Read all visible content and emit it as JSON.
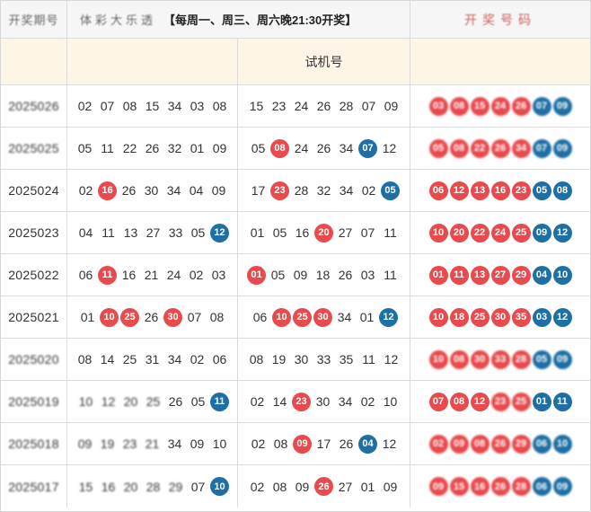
{
  "colors": {
    "red_ball": "#e84a4d",
    "blue_ball": "#1e6fa3",
    "header_bg": "#fdf6e7"
  },
  "top_bar": {
    "left_label": "开奖期号",
    "middle_prefix": "体彩大乐透",
    "draw_schedule": "【每周一、周三、周六晚21:30开奖】",
    "right_label": "开奖号码"
  },
  "header": {
    "trial_label": "试机号"
  },
  "rows": [
    {
      "date": "2025026",
      "date_blurred": true,
      "col1": [
        {
          "n": "02"
        },
        {
          "n": "07"
        },
        {
          "n": "08"
        },
        {
          "n": "15"
        },
        {
          "n": "34"
        },
        {
          "n": "03"
        },
        {
          "n": "08"
        }
      ],
      "col2": [
        {
          "n": "15"
        },
        {
          "n": "23"
        },
        {
          "n": "24"
        },
        {
          "n": "26"
        },
        {
          "n": "28"
        },
        {
          "n": "07"
        },
        {
          "n": "09"
        }
      ],
      "col3_blurred": true,
      "col3": [
        {
          "n": "03",
          "c": "r"
        },
        {
          "n": "08",
          "c": "r"
        },
        {
          "n": "15",
          "c": "r"
        },
        {
          "n": "24",
          "c": "r"
        },
        {
          "n": "26",
          "c": "r"
        },
        {
          "n": "07",
          "c": "b"
        },
        {
          "n": "09",
          "c": "b"
        }
      ]
    },
    {
      "date": "2025025",
      "date_blurred": true,
      "col1": [
        {
          "n": "05"
        },
        {
          "n": "11"
        },
        {
          "n": "22"
        },
        {
          "n": "26"
        },
        {
          "n": "32"
        },
        {
          "n": "01"
        },
        {
          "n": "09"
        }
      ],
      "col2": [
        {
          "n": "05"
        },
        {
          "n": "08",
          "c": "r"
        },
        {
          "n": "24"
        },
        {
          "n": "26"
        },
        {
          "n": "34"
        },
        {
          "n": "07",
          "c": "b"
        },
        {
          "n": "12"
        }
      ],
      "col3_blurred": true,
      "col3": [
        {
          "n": "05",
          "c": "r"
        },
        {
          "n": "08",
          "c": "r"
        },
        {
          "n": "22",
          "c": "r"
        },
        {
          "n": "26",
          "c": "r"
        },
        {
          "n": "34",
          "c": "r"
        },
        {
          "n": "07",
          "c": "b"
        },
        {
          "n": "09",
          "c": "b"
        }
      ]
    },
    {
      "date": "2025024",
      "col1": [
        {
          "n": "02"
        },
        {
          "n": "16",
          "c": "r"
        },
        {
          "n": "26"
        },
        {
          "n": "30"
        },
        {
          "n": "34"
        },
        {
          "n": "04"
        },
        {
          "n": "09"
        }
      ],
      "col2": [
        {
          "n": "17"
        },
        {
          "n": "23",
          "c": "r"
        },
        {
          "n": "28"
        },
        {
          "n": "32"
        },
        {
          "n": "34"
        },
        {
          "n": "02"
        },
        {
          "n": "05",
          "c": "b"
        }
      ],
      "col3": [
        {
          "n": "06",
          "c": "r"
        },
        {
          "n": "12",
          "c": "r"
        },
        {
          "n": "13",
          "c": "r"
        },
        {
          "n": "16",
          "c": "r"
        },
        {
          "n": "23",
          "c": "r"
        },
        {
          "n": "05",
          "c": "b"
        },
        {
          "n": "08",
          "c": "b"
        }
      ]
    },
    {
      "date": "2025023",
      "col1": [
        {
          "n": "04"
        },
        {
          "n": "11"
        },
        {
          "n": "13"
        },
        {
          "n": "27"
        },
        {
          "n": "33"
        },
        {
          "n": "05"
        },
        {
          "n": "12",
          "c": "b"
        }
      ],
      "col2": [
        {
          "n": "01"
        },
        {
          "n": "05"
        },
        {
          "n": "16"
        },
        {
          "n": "20",
          "c": "r"
        },
        {
          "n": "27"
        },
        {
          "n": "07"
        },
        {
          "n": "11"
        }
      ],
      "col3": [
        {
          "n": "10",
          "c": "r"
        },
        {
          "n": "20",
          "c": "r"
        },
        {
          "n": "22",
          "c": "r"
        },
        {
          "n": "24",
          "c": "r"
        },
        {
          "n": "25",
          "c": "r"
        },
        {
          "n": "09",
          "c": "b"
        },
        {
          "n": "12",
          "c": "b"
        }
      ]
    },
    {
      "date": "2025022",
      "col1": [
        {
          "n": "06"
        },
        {
          "n": "11",
          "c": "r"
        },
        {
          "n": "16"
        },
        {
          "n": "21"
        },
        {
          "n": "24"
        },
        {
          "n": "02"
        },
        {
          "n": "03"
        }
      ],
      "col2": [
        {
          "n": "01",
          "c": "r"
        },
        {
          "n": "05"
        },
        {
          "n": "09"
        },
        {
          "n": "18"
        },
        {
          "n": "26"
        },
        {
          "n": "03"
        },
        {
          "n": "11"
        }
      ],
      "col3": [
        {
          "n": "01",
          "c": "r"
        },
        {
          "n": "11",
          "c": "r"
        },
        {
          "n": "13",
          "c": "r"
        },
        {
          "n": "27",
          "c": "r"
        },
        {
          "n": "29",
          "c": "r"
        },
        {
          "n": "04",
          "c": "b"
        },
        {
          "n": "10",
          "c": "b"
        }
      ]
    },
    {
      "date": "2025021",
      "col1": [
        {
          "n": "01"
        },
        {
          "n": "10",
          "c": "r"
        },
        {
          "n": "25",
          "c": "r"
        },
        {
          "n": "26"
        },
        {
          "n": "30",
          "c": "r"
        },
        {
          "n": "07"
        },
        {
          "n": "08"
        }
      ],
      "col2": [
        {
          "n": "06"
        },
        {
          "n": "10",
          "c": "r"
        },
        {
          "n": "25",
          "c": "r"
        },
        {
          "n": "30",
          "c": "r"
        },
        {
          "n": "34"
        },
        {
          "n": "01"
        },
        {
          "n": "12",
          "c": "b"
        }
      ],
      "col3": [
        {
          "n": "10",
          "c": "r"
        },
        {
          "n": "18",
          "c": "r"
        },
        {
          "n": "25",
          "c": "r"
        },
        {
          "n": "30",
          "c": "r"
        },
        {
          "n": "35",
          "c": "r"
        },
        {
          "n": "03",
          "c": "b"
        },
        {
          "n": "12",
          "c": "b"
        }
      ]
    },
    {
      "date": "2025020",
      "date_blurred": true,
      "col1": [
        {
          "n": "08"
        },
        {
          "n": "14"
        },
        {
          "n": "25"
        },
        {
          "n": "31"
        },
        {
          "n": "34"
        },
        {
          "n": "02"
        },
        {
          "n": "06"
        }
      ],
      "col2": [
        {
          "n": "08"
        },
        {
          "n": "19"
        },
        {
          "n": "30"
        },
        {
          "n": "33"
        },
        {
          "n": "35"
        },
        {
          "n": "11"
        },
        {
          "n": "12"
        }
      ],
      "col3_blurred": true,
      "col3": [
        {
          "n": "10",
          "c": "r"
        },
        {
          "n": "08",
          "c": "r"
        },
        {
          "n": "30",
          "c": "r"
        },
        {
          "n": "33",
          "c": "r"
        },
        {
          "n": "28",
          "c": "r"
        },
        {
          "n": "05",
          "c": "b"
        },
        {
          "n": "09",
          "c": "b"
        }
      ]
    },
    {
      "date": "2025019",
      "date_blurred": true,
      "col1_blurred_count": 4,
      "col1": [
        {
          "n": "10"
        },
        {
          "n": "12"
        },
        {
          "n": "20"
        },
        {
          "n": "25"
        },
        {
          "n": "26"
        },
        {
          "n": "05"
        },
        {
          "n": "11",
          "c": "b"
        }
      ],
      "col2": [
        {
          "n": "02"
        },
        {
          "n": "14"
        },
        {
          "n": "23",
          "c": "r"
        },
        {
          "n": "30"
        },
        {
          "n": "34"
        },
        {
          "n": "02"
        },
        {
          "n": "10"
        }
      ],
      "col3_partial_blur_from": 3,
      "col3": [
        {
          "n": "07",
          "c": "r"
        },
        {
          "n": "08",
          "c": "r"
        },
        {
          "n": "12",
          "c": "r"
        },
        {
          "n": "23",
          "c": "r"
        },
        {
          "n": "25",
          "c": "r"
        },
        {
          "n": "01",
          "c": "b"
        },
        {
          "n": "11",
          "c": "b"
        }
      ]
    },
    {
      "date": "2025018",
      "date_blurred": true,
      "col1_blurred_count": 4,
      "col1": [
        {
          "n": "09"
        },
        {
          "n": "19"
        },
        {
          "n": "23"
        },
        {
          "n": "21"
        },
        {
          "n": "34"
        },
        {
          "n": "09"
        },
        {
          "n": "10"
        }
      ],
      "col2": [
        {
          "n": "02"
        },
        {
          "n": "08"
        },
        {
          "n": "09",
          "c": "r"
        },
        {
          "n": "17"
        },
        {
          "n": "26"
        },
        {
          "n": "04",
          "c": "b"
        },
        {
          "n": "12"
        }
      ],
      "col3_blurred": true,
      "col3": [
        {
          "n": "02",
          "c": "r"
        },
        {
          "n": "09",
          "c": "r"
        },
        {
          "n": "08",
          "c": "r"
        },
        {
          "n": "26",
          "c": "r"
        },
        {
          "n": "29",
          "c": "r"
        },
        {
          "n": "06",
          "c": "b"
        },
        {
          "n": "10",
          "c": "b"
        }
      ]
    },
    {
      "date": "2025017",
      "date_blurred": true,
      "col1_blurred_count": 5,
      "col1": [
        {
          "n": "15"
        },
        {
          "n": "16"
        },
        {
          "n": "20"
        },
        {
          "n": "28"
        },
        {
          "n": "29"
        },
        {
          "n": "07"
        },
        {
          "n": "10",
          "c": "b"
        }
      ],
      "col2": [
        {
          "n": "02"
        },
        {
          "n": "08"
        },
        {
          "n": "09"
        },
        {
          "n": "26",
          "c": "r"
        },
        {
          "n": "27"
        },
        {
          "n": "01"
        },
        {
          "n": "09"
        }
      ],
      "col3_blurred": true,
      "col3": [
        {
          "n": "09",
          "c": "r"
        },
        {
          "n": "15",
          "c": "r"
        },
        {
          "n": "16",
          "c": "r"
        },
        {
          "n": "26",
          "c": "r"
        },
        {
          "n": "28",
          "c": "r"
        },
        {
          "n": "06",
          "c": "b"
        },
        {
          "n": "09",
          "c": "b"
        }
      ]
    }
  ]
}
